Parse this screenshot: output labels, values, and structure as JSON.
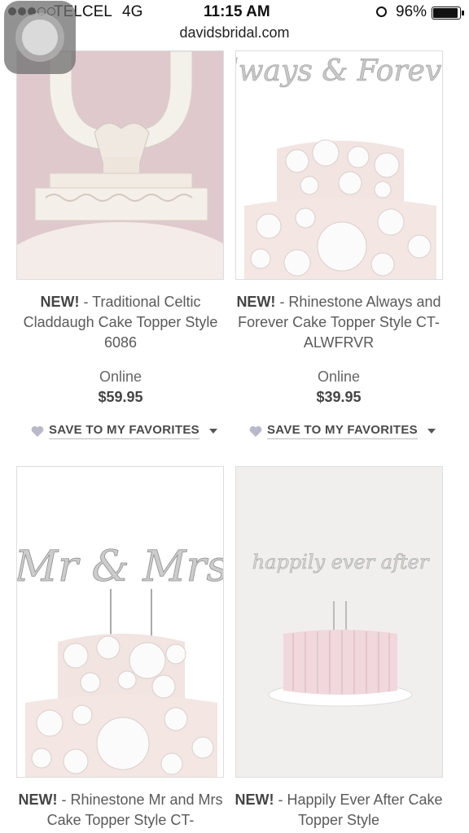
{
  "status": {
    "carrier": "TELCEL",
    "network": "4G",
    "time": "11:15 AM",
    "battery": "96%"
  },
  "browser": {
    "url": "davidsbridal.com"
  },
  "products": [
    {
      "badge": "NEW!",
      "title": " - Traditional Celtic Claddaugh Cake Topper Style 6086",
      "availability": "Online",
      "price": "$59.95",
      "fav": "SAVE TO MY FAVORITES"
    },
    {
      "badge": "NEW!",
      "title": " - Rhinestone Always and Forever Cake Topper Style CT-ALWFRVR",
      "availability": "Online",
      "price": "$39.95",
      "fav": "SAVE TO MY FAVORITES"
    },
    {
      "badge": "NEW!",
      "title": " - Rhinestone Mr and Mrs Cake Topper Style CT-",
      "image_text": "Mr & Mrs"
    },
    {
      "badge": "NEW!",
      "title": " - Happily Ever After Cake Topper Style",
      "image_text": "happily ever after"
    }
  ],
  "images": {
    "p2_topper": "Always & Forever"
  },
  "colors": {
    "heart": "#b9b9c9",
    "border": "#dddddd"
  }
}
